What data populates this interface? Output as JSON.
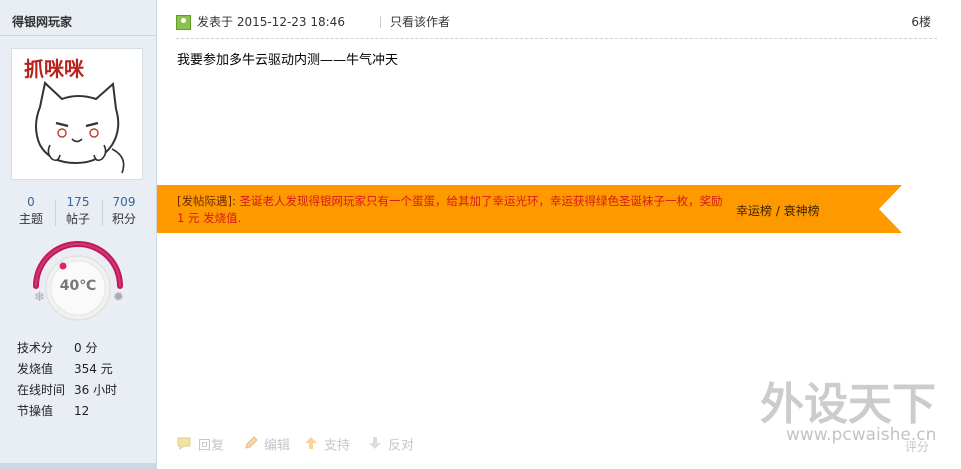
{
  "author": {
    "name": "得银网玩家",
    "avatar_text": "抓咪咪",
    "stats": [
      {
        "value": "0",
        "label": "主题"
      },
      {
        "value": "175",
        "label": "帖子"
      },
      {
        "value": "709",
        "label": "积分"
      }
    ],
    "temperature": "40℃",
    "profile": [
      {
        "key": "技术分",
        "value": "0 分"
      },
      {
        "key": "发烧值",
        "value": "354 元"
      },
      {
        "key": "在线时间",
        "value": "36 小时"
      },
      {
        "key": "节操值",
        "value": "12"
      }
    ]
  },
  "post": {
    "time": "发表于 2015-12-23 18:46",
    "only_author": "只看该作者",
    "floor": "6楼",
    "content": "我要参加多牛云驱动内测——牛气冲天"
  },
  "banner": {
    "label": "[发帖际遇]:",
    "text": " 圣诞老人发现得银网玩家只有一个蛋蛋，给其加了幸运光环，幸运获得绿色圣诞袜子一枚，奖励1 元 发烧值.",
    "links": "幸运榜 / 衰神榜",
    "color": "#ff9900"
  },
  "actions": [
    {
      "label": "回复",
      "icon": "reply-icon"
    },
    {
      "label": "编辑",
      "icon": "edit-icon"
    },
    {
      "label": "支持",
      "icon": "thumbs-up-icon"
    },
    {
      "label": "反对",
      "icon": "thumbs-down-icon"
    }
  ],
  "rate_label": "评分",
  "watermark": {
    "title": "外设天下",
    "url": "www.pcwaishe.cn"
  }
}
